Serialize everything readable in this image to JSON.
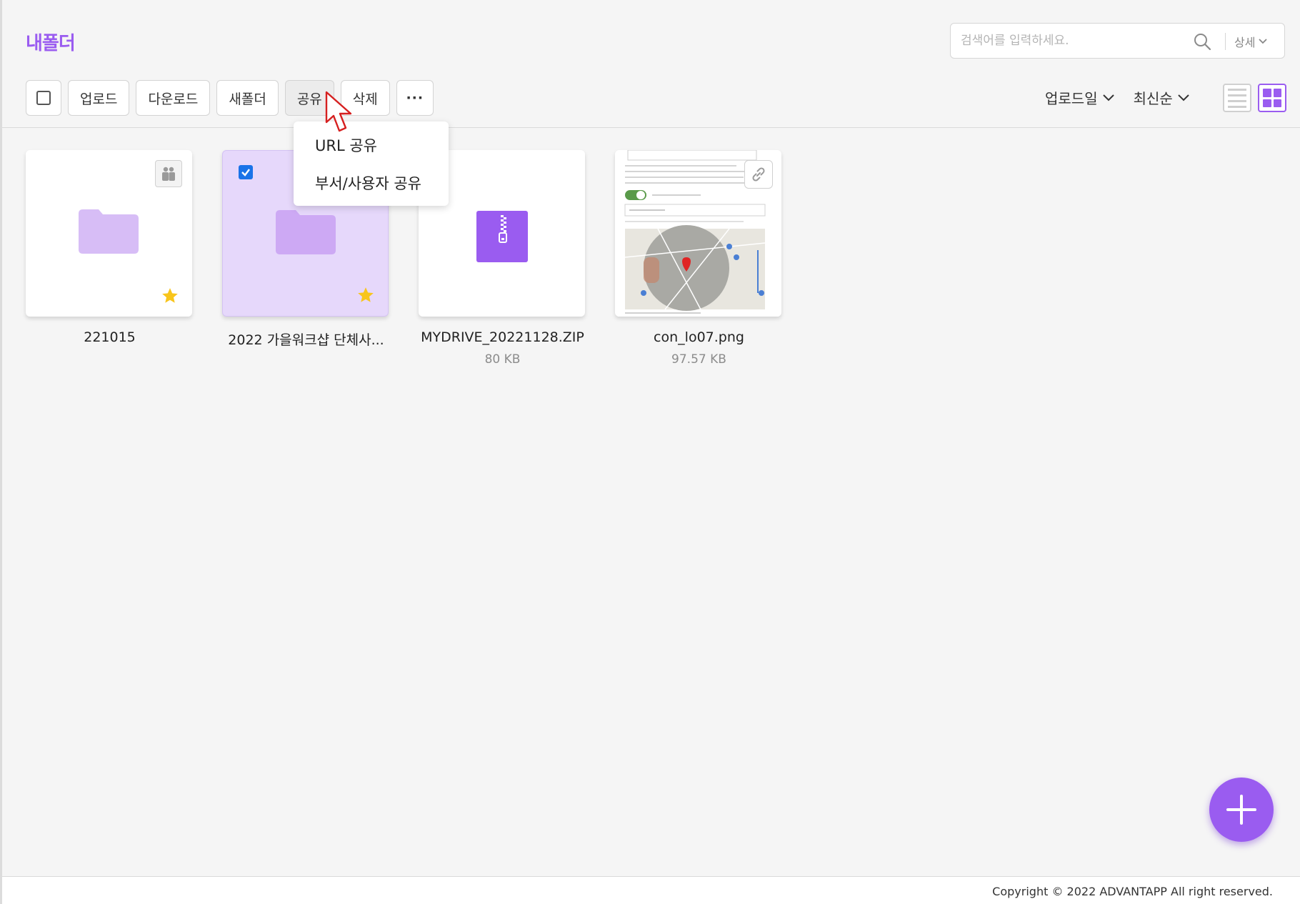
{
  "header": {
    "title": "내폴더",
    "search_placeholder": "검색어를 입력하세요.",
    "search_detail_label": "상세"
  },
  "toolbar": {
    "upload": "업로드",
    "download": "다운로드",
    "new_folder": "새폴더",
    "share": "공유",
    "delete": "삭제",
    "more": "···"
  },
  "sort": {
    "field": "업로드일",
    "order": "최신순"
  },
  "share_menu": {
    "url_share": "URL 공유",
    "dept_user_share": "부서/사용자 공유"
  },
  "items": [
    {
      "name": "221015",
      "size": "",
      "type": "folder",
      "starred": true,
      "shared": true,
      "selected": false
    },
    {
      "name": "2022 가을워크샵 단체사...",
      "size": "",
      "type": "folder",
      "starred": true,
      "shared": false,
      "selected": true
    },
    {
      "name": "MYDRIVE_20221128.ZIP",
      "size": "80 KB",
      "type": "zip",
      "starred": false,
      "shared": false,
      "selected": false
    },
    {
      "name": "con_lo07.png",
      "size": "97.57 KB",
      "type": "image",
      "starred": false,
      "shared": false,
      "selected": false
    }
  ],
  "footer": {
    "copyright": "Copyright © 2022 ADVANTAPP All right reserved."
  },
  "colors": {
    "accent": "#9a5cf0",
    "folder": "#d7bdf6",
    "star": "#f8c51c",
    "selected_card": "#e6d8fb"
  }
}
